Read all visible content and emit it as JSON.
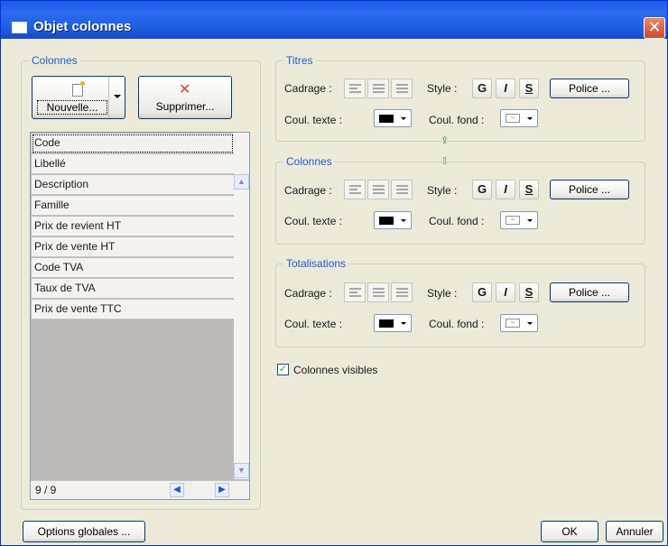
{
  "window": {
    "title": "Objet colonnes",
    "close": "✕"
  },
  "columns_group": {
    "legend": "Colonnes",
    "new_button": "Nouvelle...",
    "delete_button": "Supprimer...",
    "items": [
      "Code",
      "Libellé",
      "Description",
      "Famille",
      "Prix de revient HT",
      "Prix de vente HT",
      "Code TVA",
      "Taux de TVA",
      "Prix de vente TTC"
    ],
    "counter": "9 / 9"
  },
  "sections": [
    {
      "legend": "Titres",
      "cadrage_label": "Cadrage :",
      "style_label": "Style :",
      "bold": "G",
      "italic": "I",
      "strike": "S",
      "police_button": "Police ...",
      "text_color_label": "Coul. texte :",
      "bg_color_label": "Coul. fond :"
    },
    {
      "legend": "Colonnes",
      "cadrage_label": "Cadrage :",
      "style_label": "Style :",
      "bold": "G",
      "italic": "I",
      "strike": "S",
      "police_button": "Police ...",
      "text_color_label": "Coul. texte :",
      "bg_color_label": "Coul. fond :"
    },
    {
      "legend": "Totalisations",
      "cadrage_label": "Cadrage :",
      "style_label": "Style :",
      "bold": "G",
      "italic": "I",
      "strike": "S",
      "police_button": "Police ...",
      "text_color_label": "Coul. texte :",
      "bg_color_label": "Coul. fond :"
    }
  ],
  "visible_columns": {
    "label": "Colonnes visibles",
    "checked": true
  },
  "footer": {
    "global_options": "Options globales ...",
    "ok": "OK",
    "cancel": "Annuler"
  },
  "colors": {
    "title_bar": "#1E5FE0",
    "legend": "#1E5FD0",
    "dialog_bg": "#ECE9D8"
  }
}
